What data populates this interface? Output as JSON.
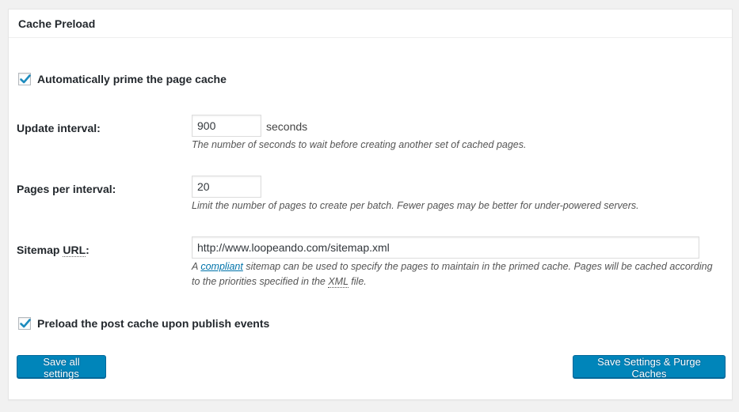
{
  "panel": {
    "title": "Cache Preload"
  },
  "auto_prime": {
    "label": "Automatically prime the page cache",
    "checked": true
  },
  "update_interval": {
    "label": "Update interval:",
    "value": "900",
    "unit": "seconds",
    "description": "The number of seconds to wait before creating another set of cached pages."
  },
  "pages_per_interval": {
    "label": "Pages per interval:",
    "value": "20",
    "description": "Limit the number of pages to create per batch. Fewer pages may be better for under-powered servers."
  },
  "sitemap": {
    "label_prefix": "Sitemap ",
    "label_abbr": "URL",
    "label_suffix": ":",
    "value": "http://www.loopeando.com/sitemap.xml",
    "desc_part1": "A ",
    "desc_link": "compliant",
    "desc_part2": " sitemap can be used to specify the pages to maintain in the primed cache. Pages will be cached according",
    "desc_part3": "to the priorities specified in the ",
    "desc_abbr": "XML",
    "desc_part4": " file."
  },
  "preload_post": {
    "label": "Preload the post cache upon publish events",
    "checked": true
  },
  "buttons": {
    "save_all": "Save all settings",
    "save_purge": "Save Settings & Purge Caches"
  },
  "colors": {
    "primary": "#0085ba",
    "checkmark": "#1e8cbe",
    "link": "#0073aa"
  },
  "icons": {
    "checkbox_checked": "checkmark-icon"
  }
}
